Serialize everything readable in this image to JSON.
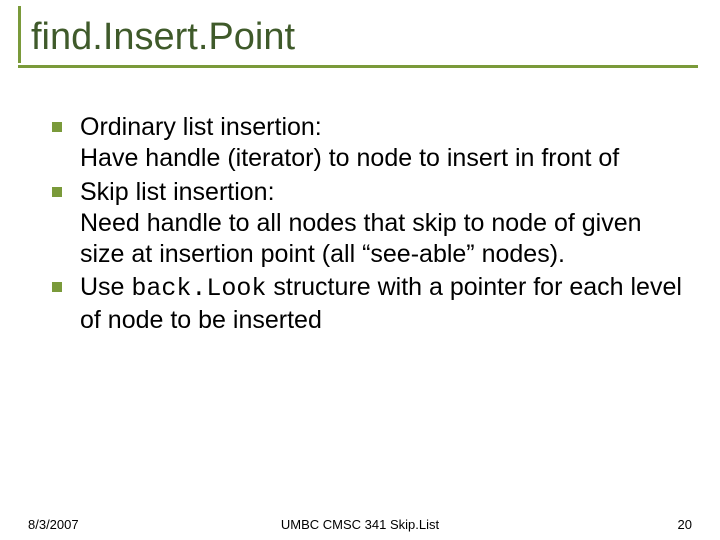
{
  "title": "find.Insert.Point",
  "bullets": [
    {
      "head": "Ordinary list insertion:",
      "body": "Have handle (iterator) to node to insert in front of"
    },
    {
      "head": "Skip list insertion:",
      "body": "Need handle to all nodes that skip to node of given size at insertion point (all “see-able” nodes)."
    },
    {
      "head_pre": "Use ",
      "head_code": "back.Look",
      "head_post": " structure with a pointer for each level of node to be inserted"
    }
  ],
  "footer": {
    "date": "8/3/2007",
    "center": "UMBC CMSC 341 Skip.List",
    "page": "20"
  }
}
